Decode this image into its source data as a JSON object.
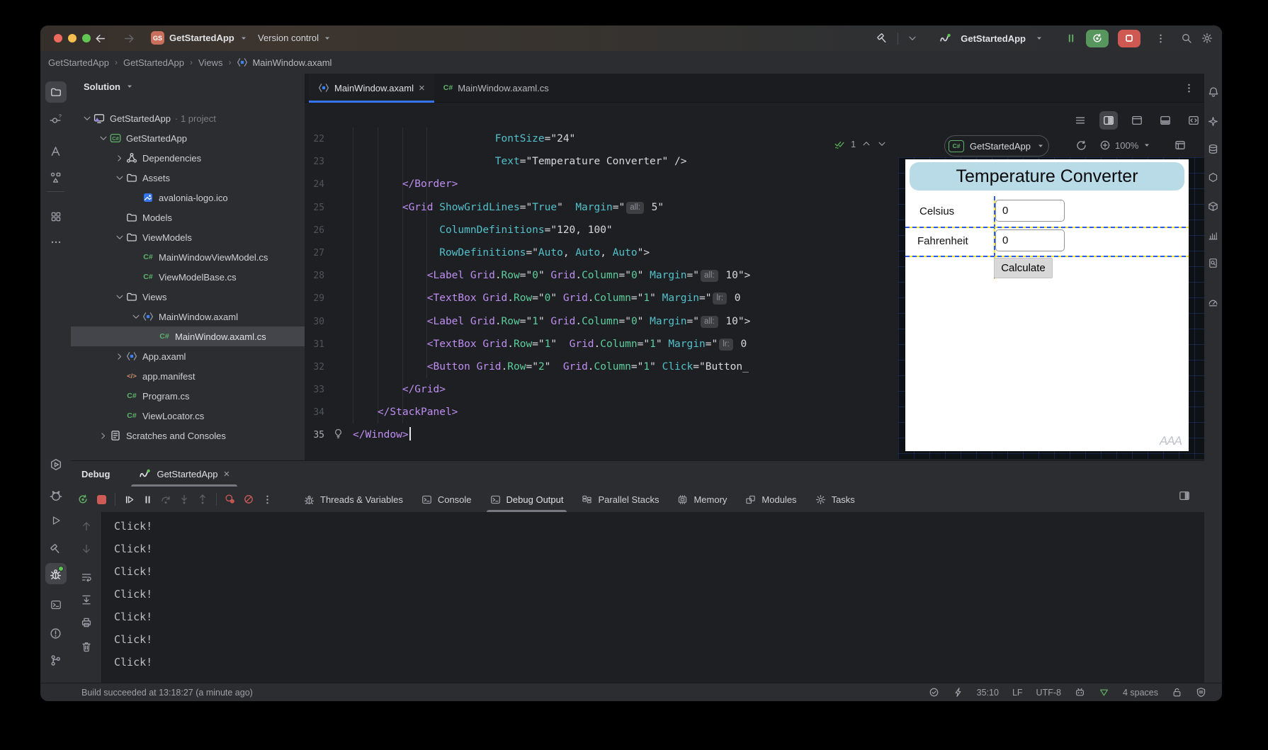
{
  "titlebar": {
    "project_badge": "GS",
    "project_name": "GetStartedApp",
    "version_control": "Version control",
    "run_config": "GetStartedApp"
  },
  "breadcrumb": {
    "items": [
      "GetStartedApp",
      "GetStartedApp",
      "Views",
      "MainWindow.axaml"
    ]
  },
  "left_rail": {
    "top": [
      {
        "icon": "folder",
        "name": "project-tool",
        "active": true
      },
      {
        "icon": "vcs",
        "name": "commit-tool"
      },
      {
        "icon": "amono",
        "name": "pull-requests-tool"
      },
      {
        "icon": "structure",
        "name": "structure-tool"
      },
      {
        "icon": "buildsq",
        "name": "build-tool"
      },
      {
        "icon": "dotsh",
        "name": "more-tools"
      }
    ],
    "bottom": [
      {
        "icon": "hexplay",
        "name": "services-tool"
      },
      {
        "icon": "cat",
        "name": "ai-assistant-tool"
      },
      {
        "icon": "play",
        "name": "run-tool"
      },
      {
        "icon": "hammer",
        "name": "build-hammer-tool"
      },
      {
        "icon": "bug",
        "name": "debug-tool",
        "active": true,
        "green_dot": true
      },
      {
        "icon": "terminal",
        "name": "terminal-tool"
      },
      {
        "icon": "problems",
        "name": "problems-tool"
      },
      {
        "icon": "branch",
        "name": "git-tool"
      }
    ]
  },
  "right_rail": {
    "items": [
      {
        "icon": "bell",
        "name": "notifications"
      },
      {
        "icon": "ai",
        "name": "ai-assistant"
      },
      {
        "icon": "db",
        "name": "database-tool"
      },
      {
        "icon": "hexagon",
        "name": "endpoints-tool"
      },
      {
        "icon": "package",
        "name": "nuget-tool"
      },
      {
        "icon": "chart",
        "name": "profiler-tool"
      },
      {
        "icon": "docmag",
        "name": "find-tool"
      },
      {
        "icon": "gauge",
        "name": "monitoring-tool"
      }
    ]
  },
  "solution": {
    "header": "Solution",
    "tree": [
      {
        "label": "GetStartedApp",
        "badge": "· 1 project",
        "icon": "solution",
        "lvl": 0,
        "chev": "down"
      },
      {
        "label": "GetStartedApp",
        "icon": "csproj",
        "lvl": 1,
        "chev": "down"
      },
      {
        "label": "Dependencies",
        "icon": "deps",
        "lvl": 2,
        "chev": "right"
      },
      {
        "label": "Assets",
        "icon": "folder",
        "lvl": 2,
        "chev": "down"
      },
      {
        "label": "avalonia-logo.ico",
        "icon": "image",
        "lvl": 3
      },
      {
        "label": "Models",
        "icon": "folder",
        "lvl": 2
      },
      {
        "label": "ViewModels",
        "icon": "folder",
        "lvl": 2,
        "chev": "down"
      },
      {
        "label": "MainWindowViewModel.cs",
        "icon": "cs",
        "lvl": 3
      },
      {
        "label": "ViewModelBase.cs",
        "icon": "cs",
        "lvl": 3
      },
      {
        "label": "Views",
        "icon": "folder",
        "lvl": 2,
        "chev": "down"
      },
      {
        "label": "MainWindow.axaml",
        "icon": "axaml",
        "lvl": 3,
        "chev": "down"
      },
      {
        "label": "MainWindow.axaml.cs",
        "icon": "cs",
        "lvl": 4,
        "selected": true
      },
      {
        "label": "App.axaml",
        "icon": "axaml",
        "lvl": 2,
        "chev": "right"
      },
      {
        "label": "app.manifest",
        "icon": "manifest",
        "lvl": 2
      },
      {
        "label": "Program.cs",
        "icon": "cs",
        "lvl": 2
      },
      {
        "label": "ViewLocator.cs",
        "icon": "cs",
        "lvl": 2
      },
      {
        "label": "Scratches and Consoles",
        "icon": "scratches",
        "lvl": 1,
        "chev": "right"
      }
    ]
  },
  "editor": {
    "tabs": [
      {
        "label": "MainWindow.axaml",
        "icon": "axaml",
        "active": true,
        "closable": true
      },
      {
        "label": "MainWindow.axaml.cs",
        "icon": "cs"
      }
    ],
    "inspection_count": "1",
    "preview_config": "GetStartedApp",
    "zoom": "100%",
    "lines": [
      {
        "n": "22",
        "segs": [
          [
            "pl",
            "                       "
          ],
          [
            "at",
            "FontSize"
          ],
          [
            "pl",
            "=\"24\""
          ]
        ]
      },
      {
        "n": "23",
        "segs": [
          [
            "pl",
            "                       "
          ],
          [
            "at",
            "Text"
          ],
          [
            "pl",
            "=\"Temperature Converter\" />"
          ]
        ]
      },
      {
        "n": "24",
        "segs": [
          [
            "pl",
            "        "
          ],
          [
            "tg",
            "</Border>"
          ]
        ]
      },
      {
        "n": "25",
        "segs": [
          [
            "pl",
            "        "
          ],
          [
            "tg",
            "<Grid"
          ],
          [
            "pl",
            " "
          ],
          [
            "at",
            "ShowGridLines"
          ],
          [
            "pl",
            "=\""
          ],
          [
            "vl",
            "True"
          ],
          [
            "pl",
            "\"  "
          ],
          [
            "at",
            "Margin"
          ],
          [
            "pl",
            "=\""
          ],
          [
            "hint",
            "all:"
          ],
          [
            "pl",
            " 5\""
          ]
        ]
      },
      {
        "n": "26",
        "segs": [
          [
            "pl",
            "              "
          ],
          [
            "at",
            "ColumnDefinitions"
          ],
          [
            "pl",
            "=\"120, 100\""
          ]
        ]
      },
      {
        "n": "27",
        "segs": [
          [
            "pl",
            "              "
          ],
          [
            "at",
            "RowDefinitions"
          ],
          [
            "pl",
            "=\""
          ],
          [
            "vl",
            "Auto"
          ],
          [
            "pl",
            ", "
          ],
          [
            "vl",
            "Auto"
          ],
          [
            "pl",
            ", "
          ],
          [
            "vl",
            "Auto"
          ],
          [
            "pl",
            "\">"
          ]
        ]
      },
      {
        "n": "28",
        "segs": [
          [
            "pl",
            "            "
          ],
          [
            "tg",
            "<Label"
          ],
          [
            "pl",
            " "
          ],
          [
            "tg",
            "Grid"
          ],
          [
            "pl",
            "."
          ],
          [
            "gr",
            "Row"
          ],
          [
            "pl",
            "=\""
          ],
          [
            "gr",
            "0"
          ],
          [
            "pl",
            "\" "
          ],
          [
            "tg",
            "Grid"
          ],
          [
            "pl",
            "."
          ],
          [
            "gr",
            "Column"
          ],
          [
            "pl",
            "=\""
          ],
          [
            "gr",
            "0"
          ],
          [
            "pl",
            "\" "
          ],
          [
            "at",
            "Margin"
          ],
          [
            "pl",
            "=\""
          ],
          [
            "hint",
            "all:"
          ],
          [
            "pl",
            " 10\">"
          ]
        ]
      },
      {
        "n": "29",
        "segs": [
          [
            "pl",
            "            "
          ],
          [
            "tg",
            "<TextBox"
          ],
          [
            "pl",
            " "
          ],
          [
            "tg",
            "Grid"
          ],
          [
            "pl",
            "."
          ],
          [
            "gr",
            "Row"
          ],
          [
            "pl",
            "=\""
          ],
          [
            "gr",
            "0"
          ],
          [
            "pl",
            "\" "
          ],
          [
            "tg",
            "Grid"
          ],
          [
            "pl",
            "."
          ],
          [
            "gr",
            "Column"
          ],
          [
            "pl",
            "=\""
          ],
          [
            "gr",
            "1"
          ],
          [
            "pl",
            "\" "
          ],
          [
            "at",
            "Margin"
          ],
          [
            "pl",
            "=\""
          ],
          [
            "hint",
            "lr:"
          ],
          [
            "pl",
            " 0"
          ]
        ]
      },
      {
        "n": "30",
        "segs": [
          [
            "pl",
            "            "
          ],
          [
            "tg",
            "<Label"
          ],
          [
            "pl",
            " "
          ],
          [
            "tg",
            "Grid"
          ],
          [
            "pl",
            "."
          ],
          [
            "gr",
            "Row"
          ],
          [
            "pl",
            "=\""
          ],
          [
            "gr",
            "1"
          ],
          [
            "pl",
            "\" "
          ],
          [
            "tg",
            "Grid"
          ],
          [
            "pl",
            "."
          ],
          [
            "gr",
            "Column"
          ],
          [
            "pl",
            "=\""
          ],
          [
            "gr",
            "0"
          ],
          [
            "pl",
            "\" "
          ],
          [
            "at",
            "Margin"
          ],
          [
            "pl",
            "=\""
          ],
          [
            "hint",
            "all:"
          ],
          [
            "pl",
            " 10\">"
          ]
        ]
      },
      {
        "n": "31",
        "segs": [
          [
            "pl",
            "            "
          ],
          [
            "tg",
            "<TextBox"
          ],
          [
            "pl",
            " "
          ],
          [
            "tg",
            "Grid"
          ],
          [
            "pl",
            "."
          ],
          [
            "gr",
            "Row"
          ],
          [
            "pl",
            "=\""
          ],
          [
            "gr",
            "1"
          ],
          [
            "pl",
            "\"  "
          ],
          [
            "tg",
            "Grid"
          ],
          [
            "pl",
            "."
          ],
          [
            "gr",
            "Column"
          ],
          [
            "pl",
            "=\""
          ],
          [
            "gr",
            "1"
          ],
          [
            "pl",
            "\" "
          ],
          [
            "at",
            "Margin"
          ],
          [
            "pl",
            "=\""
          ],
          [
            "hint",
            "lr:"
          ],
          [
            "pl",
            " 0"
          ]
        ]
      },
      {
        "n": "32",
        "segs": [
          [
            "pl",
            "            "
          ],
          [
            "tg",
            "<Button"
          ],
          [
            "pl",
            " "
          ],
          [
            "tg",
            "Grid"
          ],
          [
            "pl",
            "."
          ],
          [
            "gr",
            "Row"
          ],
          [
            "pl",
            "=\""
          ],
          [
            "gr",
            "2"
          ],
          [
            "pl",
            "\"  "
          ],
          [
            "tg",
            "Grid"
          ],
          [
            "pl",
            "."
          ],
          [
            "gr",
            "Column"
          ],
          [
            "pl",
            "=\""
          ],
          [
            "gr",
            "1"
          ],
          [
            "pl",
            "\" "
          ],
          [
            "at",
            "Click"
          ],
          [
            "pl",
            "=\"Button_"
          ]
        ]
      },
      {
        "n": "33",
        "segs": [
          [
            "pl",
            "        "
          ],
          [
            "tg",
            "</Grid>"
          ]
        ]
      },
      {
        "n": "34",
        "segs": [
          [
            "pl",
            "    "
          ],
          [
            "tg",
            "</StackPanel>"
          ]
        ]
      },
      {
        "n": "35",
        "segs": [
          [
            "tg",
            "</Window>"
          ]
        ],
        "caret": true,
        "bulb": true
      }
    ]
  },
  "preview": {
    "title": "Temperature Converter",
    "rows": [
      {
        "label": "Celsius",
        "value": "0"
      },
      {
        "label": "Fahrenheit",
        "value": "0"
      }
    ],
    "button": "Calculate",
    "watermark": "AAA"
  },
  "debug": {
    "title": "Debug",
    "session_tab": "GetStartedApp",
    "toolbar": [
      {
        "icon": "restart",
        "name": "rerun-button",
        "cls": "green"
      },
      {
        "icon": "stopfill",
        "name": "stop-button",
        "cls": "red"
      },
      {
        "divider": true
      },
      {
        "icon": "resume",
        "name": "resume-button",
        "cls": "bright"
      },
      {
        "icon": "pausew",
        "name": "pause-button",
        "cls": "bright"
      },
      {
        "icon": "stepover",
        "name": "step-over-button",
        "cls": "dim"
      },
      {
        "icon": "stepinto",
        "name": "step-into-button",
        "cls": "dim"
      },
      {
        "icon": "stepout",
        "name": "step-out-button",
        "cls": "dim"
      },
      {
        "divider": true
      },
      {
        "icon": "mutebp",
        "name": "mute-breakpoints-button",
        "cls": "red"
      },
      {
        "icon": "slash",
        "name": "view-breakpoints-button",
        "cls": "red"
      },
      {
        "icon": "kebab",
        "name": "debug-more-button"
      }
    ],
    "tabs": [
      {
        "label": "Threads & Variables",
        "icon": "bug"
      },
      {
        "label": "Console",
        "icon": "terminal"
      },
      {
        "label": "Debug Output",
        "icon": "terminal",
        "active": true
      },
      {
        "label": "Parallel Stacks",
        "icon": "stacks"
      },
      {
        "label": "Memory",
        "icon": "memory"
      },
      {
        "label": "Modules",
        "icon": "modules"
      },
      {
        "label": "Tasks",
        "icon": "tasks"
      }
    ],
    "mini_toolbar": [
      {
        "icon": "uparrow",
        "name": "prev-occurrence-button",
        "dim": true
      },
      {
        "icon": "downarrow",
        "name": "next-occurrence-button",
        "dim": true
      },
      {
        "icon": "wrap",
        "name": "soft-wrap-button"
      },
      {
        "icon": "scrollend",
        "name": "scroll-to-end-button"
      },
      {
        "icon": "printer",
        "name": "print-button"
      },
      {
        "icon": "trash",
        "name": "clear-output-button"
      }
    ],
    "output": [
      "Click!",
      "Click!",
      "Click!",
      "Click!",
      "Click!",
      "Click!",
      "Click!"
    ]
  },
  "status_bar": {
    "build_message": "Build succeeded at 13:18:27 (a minute ago)",
    "items": [
      {
        "icon": "checkcircle",
        "name": "inspections-status-icon"
      },
      {
        "icon": "lightning",
        "name": "power-save-icon"
      },
      {
        "text": "35:10",
        "name": "caret-position"
      },
      {
        "text": "LF",
        "name": "line-separator"
      },
      {
        "text": "UTF-8",
        "name": "file-encoding"
      },
      {
        "icon": "robot",
        "name": "ai-status-icon"
      },
      {
        "icon": "triangle",
        "name": "hot-reload-icon",
        "green": true
      },
      {
        "text": "4 spaces",
        "name": "indent-style"
      },
      {
        "icon": "lock",
        "name": "file-lock-icon"
      },
      {
        "icon": "shield",
        "name": "security-status-icon"
      }
    ]
  },
  "colors": {
    "accent": "#3574f0",
    "green": "#5fad65",
    "red": "#cd5952",
    "editor_bg": "#1e1f22",
    "panel_bg": "#2b2d30",
    "preview_header_bg": "#b9dbe7",
    "grid_line_blue": "#2d5de0",
    "grid_line_yellow": "#f7e33c"
  }
}
